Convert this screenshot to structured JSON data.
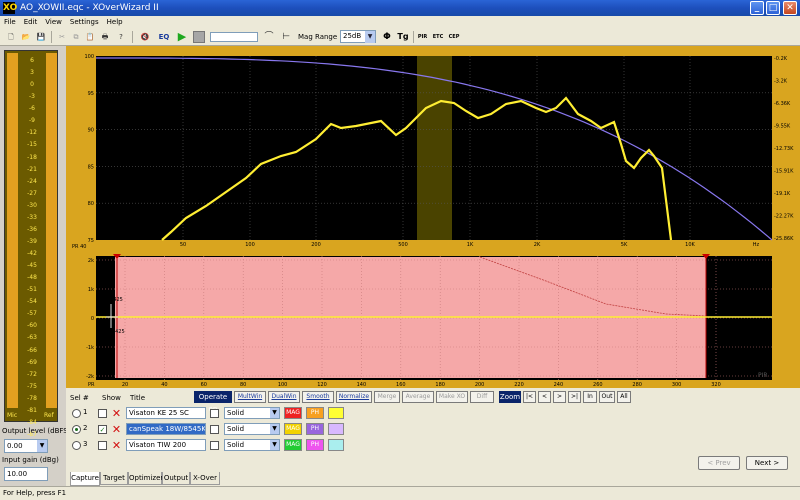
{
  "window": {
    "app_icon": "XO",
    "title": "AO_XOWII.eqc - XOverWizard II",
    "min": "_",
    "max": "□",
    "close": "✕"
  },
  "menu": [
    "File",
    "Edit",
    "View",
    "Settings",
    "Help"
  ],
  "toolbar": {
    "eq_label": "EQ",
    "mag_range_label": "Mag Range",
    "mag_range_value": "25dB",
    "phase_glyph": "Φ",
    "tg_label": "Tg",
    "pir_label": "PIR",
    "etc_label": "ETC",
    "cep_label": "CEP"
  },
  "vu_meter": {
    "scale": [
      "6",
      "3",
      "0",
      "-3",
      "-6",
      "-9",
      "-12",
      "-15",
      "-18",
      "-21",
      "-24",
      "-27",
      "-30",
      "-33",
      "-36",
      "-39",
      "-42",
      "-45",
      "-48",
      "-51",
      "-54",
      "-57",
      "-60",
      "-63",
      "-66",
      "-69",
      "-72",
      "-75",
      "-78",
      "-81",
      "-84",
      "-87",
      "-90"
    ],
    "left_label": "Mic",
    "right_label": "Ref",
    "left_level": 1.0,
    "right_level": 1.0
  },
  "output_level": {
    "label": "Output level (dBFS)",
    "value": "0.00"
  },
  "input_gain": {
    "label": "Input gain (dBg)",
    "value": "10.00"
  },
  "freq_plot": {
    "y_left_ticks": [
      "100",
      "95",
      "90",
      "85",
      "80",
      "75"
    ],
    "y_right_ticks": [
      "-0.2K",
      "-3.2K",
      "-6.36K",
      "-9.55K",
      "-12.73K",
      "-15.91K",
      "-19.1K",
      "-22.27K",
      "-25.86K"
    ],
    "x_ticks": [
      "50",
      "100",
      "200",
      "500",
      "1K",
      "2K",
      "5K",
      "10K",
      "Hz"
    ],
    "corner_label": "PR 40"
  },
  "time_plot": {
    "y_ticks": [
      "2k",
      "1k",
      "0",
      "-1k",
      "-2k"
    ],
    "annotations": [
      "891.5425",
      "-891.5425"
    ],
    "x_ticks": [
      "20",
      "40",
      "60",
      "80",
      "100",
      "120",
      "140",
      "160",
      "180",
      "200",
      "220",
      "240",
      "260",
      "280",
      "300",
      "320"
    ],
    "corner_label": "PIR",
    "pr_label": "PR"
  },
  "controls": {
    "header": {
      "sel": "Sel #",
      "show": "Show",
      "title": "Title"
    },
    "operate_on": "Operate on",
    "op_buttons": [
      "MultWin",
      "DualWin",
      "Smooth",
      "Normalize",
      "Merge",
      "Average",
      "Make XO",
      "Diff"
    ],
    "zoom_label": "Zoom",
    "zoom_buttons": [
      "|<",
      "<",
      ">",
      ">|",
      "In",
      "Out",
      "All"
    ],
    "rows": [
      {
        "num": "1",
        "title": "Visaton KE 25 SC",
        "style": "Solid",
        "mag": "MAG",
        "ph": "PH",
        "selected": false,
        "shown": false
      },
      {
        "num": "2",
        "title": "canSpeak 18W/8545K00",
        "style": "Solid",
        "mag": "MAG",
        "ph": "PH",
        "selected": true,
        "shown": true
      },
      {
        "num": "3",
        "title": "Visaton TIW 200",
        "style": "Solid",
        "mag": "MAG",
        "ph": "PH",
        "selected": false,
        "shown": false
      }
    ],
    "prev": "< Prev",
    "next": "Next >"
  },
  "tabs": [
    "Capture",
    "Target",
    "Optimizer",
    "Output",
    "X-Over"
  ],
  "status": "For Help, press F1",
  "colors": {
    "plot_frame": "#d9a51f",
    "response": "#ffee33",
    "target": "#8877ee",
    "time_bg": "#f5a8a8"
  }
}
